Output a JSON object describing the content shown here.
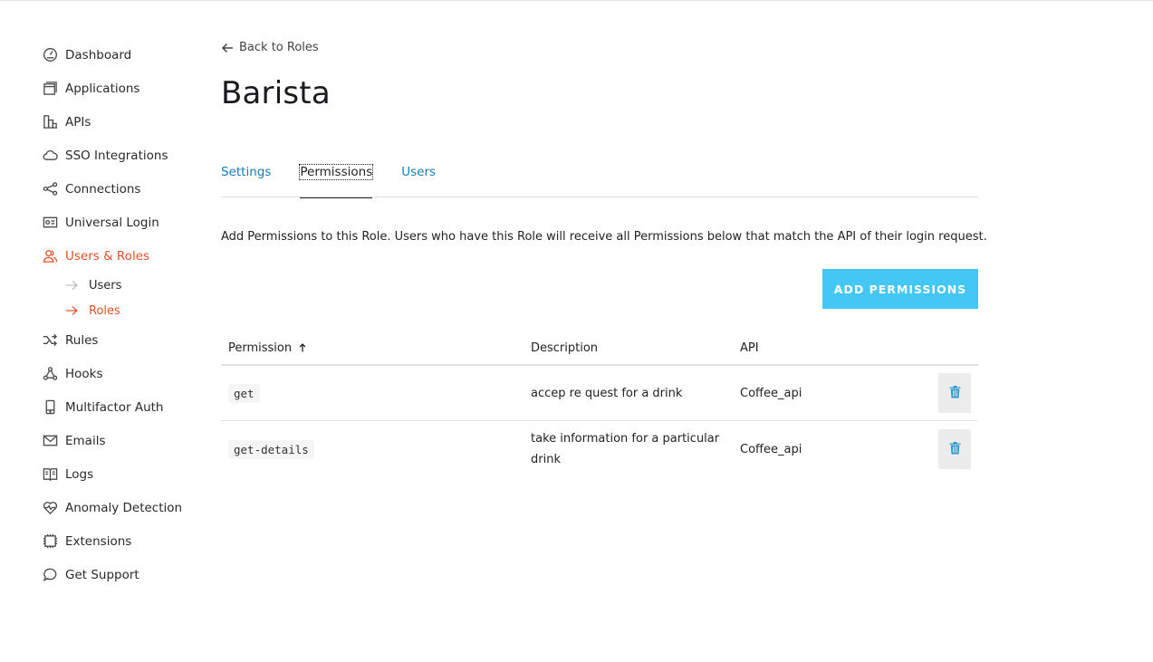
{
  "sidebar": {
    "items": [
      {
        "label": "Dashboard",
        "icon": "dashboard-icon"
      },
      {
        "label": "Applications",
        "icon": "applications-icon"
      },
      {
        "label": "APIs",
        "icon": "apis-icon"
      },
      {
        "label": "SSO Integrations",
        "icon": "cloud-icon"
      },
      {
        "label": "Connections",
        "icon": "connections-icon"
      },
      {
        "label": "Universal Login",
        "icon": "universal-login-icon"
      },
      {
        "label": "Users & Roles",
        "icon": "users-icon",
        "active": true
      },
      {
        "label": "Rules",
        "icon": "rules-icon"
      },
      {
        "label": "Hooks",
        "icon": "hooks-icon"
      },
      {
        "label": "Multifactor Auth",
        "icon": "phone-icon"
      },
      {
        "label": "Emails",
        "icon": "mail-icon"
      },
      {
        "label": "Logs",
        "icon": "book-icon"
      },
      {
        "label": "Anomaly Detection",
        "icon": "heart-icon"
      },
      {
        "label": "Extensions",
        "icon": "extensions-icon"
      },
      {
        "label": "Get Support",
        "icon": "chat-icon"
      }
    ],
    "subitems": [
      {
        "label": "Users"
      },
      {
        "label": "Roles",
        "active": true
      }
    ]
  },
  "main": {
    "back_label": "Back to Roles",
    "title": "Barista",
    "tabs": [
      {
        "label": "Settings"
      },
      {
        "label": "Permissions",
        "active": true
      },
      {
        "label": "Users"
      }
    ],
    "intro": "Add Permissions to this Role. Users who have this Role will receive all Permissions below that match the API of their login request.",
    "add_button": "ADD PERMISSIONS"
  },
  "table": {
    "headers": {
      "permission": "Permission",
      "description": "Description",
      "api": "API"
    },
    "rows": [
      {
        "permission": "get",
        "description": "accep re quest for a drink",
        "api": "Coffee_api"
      },
      {
        "permission": "get-details",
        "description": "take information for a particular drink",
        "api": "Coffee_api"
      }
    ]
  },
  "colors": {
    "accent": "#e8502a",
    "link": "#167db8",
    "button": "#44c7f4",
    "delete_icon": "#2e9ad0"
  }
}
